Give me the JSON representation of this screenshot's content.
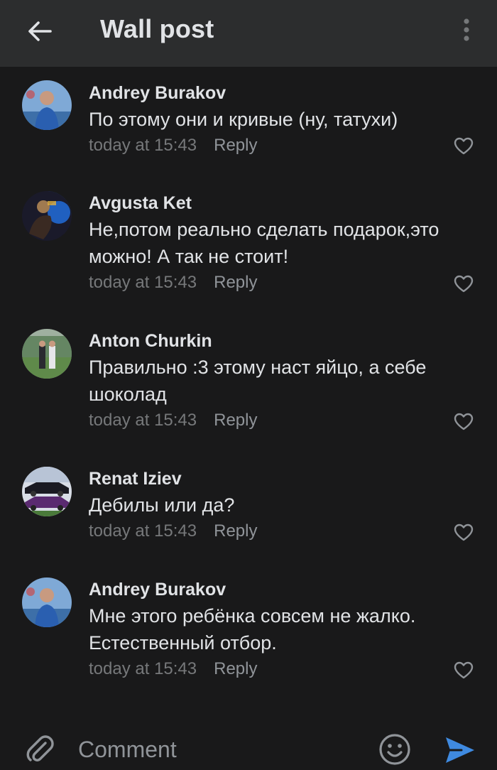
{
  "header": {
    "title": "Wall post",
    "back_icon": "arrow-left-icon",
    "menu_icon": "more-vertical-icon"
  },
  "comments": [
    {
      "author": "Andrey Burakov",
      "text": "По этому они и кривые (ну, татухи)",
      "time": "today at 15:43",
      "reply_label": "Reply"
    },
    {
      "author": "Avgusta Ket",
      "text": "Не,потом реально сделать подарок,это можно! А так не стоит!",
      "time": "today at 15:43",
      "reply_label": "Reply"
    },
    {
      "author": "Anton Churkin",
      "text": "Правильно :3  этому  наст яйцо, а себе шоколад",
      "time": "today at 15:43",
      "reply_label": "Reply"
    },
    {
      "author": "Renat Iziev",
      "text": "Дебилы или да?",
      "time": "today at 15:43",
      "reply_label": "Reply"
    },
    {
      "author": "Andrey Burakov",
      "text": "Мне этого ребёнка совсем не жалко. Естественный отбор.",
      "time": "today at 15:43",
      "reply_label": "Reply"
    }
  ],
  "composer": {
    "placeholder": "Comment",
    "attach_icon": "paperclip-icon",
    "emoji_icon": "smiley-icon",
    "send_icon": "send-icon"
  },
  "colors": {
    "background": "#19191a",
    "header": "#2c2d2e",
    "text": "#e1e3e6",
    "secondary": "#76787a",
    "accent": "#3f8ae0"
  }
}
